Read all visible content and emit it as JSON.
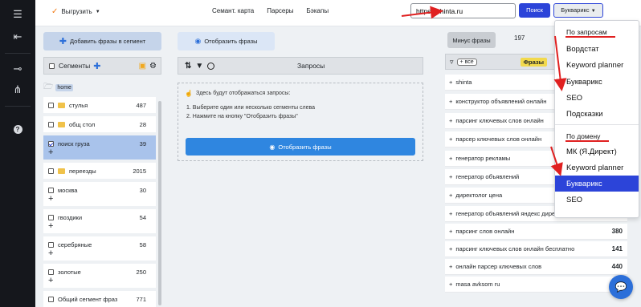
{
  "colors": {
    "accent": "#2c44d9",
    "annotation": "#e02020",
    "selected_row": "#a9c3eb"
  },
  "rail": {
    "icons": [
      "menu-icon",
      "logout-icon",
      "key-icon",
      "hierarchy-icon",
      "help-icon"
    ]
  },
  "topbar": {
    "export_label": "Выгрузить",
    "nav": [
      "Семант. карта",
      "Парсеры",
      "Бэкапы"
    ],
    "url_value": "https://shinta.ru",
    "search_label": "Поиск",
    "provider_label": "Букварикс"
  },
  "segments_panel": {
    "add_button": "Добавить фразы в сегмент",
    "header": "Сегменты",
    "home_label": "home",
    "items": [
      {
        "label": "стулья",
        "count": "487",
        "folder": true,
        "checked": false
      },
      {
        "label": "общ стол",
        "count": "28",
        "folder": true,
        "checked": false
      },
      {
        "label": "поиск груза",
        "count": "39",
        "folder": false,
        "checked": true
      },
      {
        "label": "переезды",
        "count": "2015",
        "folder": true,
        "checked": false
      },
      {
        "label": "москва",
        "count": "30",
        "folder": false,
        "checked": false
      },
      {
        "label": "гвоздики",
        "count": "54",
        "folder": false,
        "checked": false
      },
      {
        "label": "серебряные",
        "count": "58",
        "folder": false,
        "checked": false
      },
      {
        "label": "золотые",
        "count": "250",
        "folder": false,
        "checked": false
      },
      {
        "label": "Общий сегмент фраз",
        "count": "771",
        "folder": false,
        "checked": false
      }
    ]
  },
  "queries_panel": {
    "show_button": "Отобразить фразы",
    "header": "Запросы",
    "hint_title": "Здесь будут отображаться запросы:",
    "hint_steps": [
      "1. Выберите один или несколько сегменты слева",
      "2. Нажмите на кнопку \"Отобразить фразы\""
    ],
    "show_button_big": "Отобразить фразы"
  },
  "right_panel": {
    "minus_button": "Минус фразы",
    "count": "197",
    "filter_all": "+ все",
    "phrases_badge": "Фразы",
    "rows": [
      {
        "text": "shinta",
        "num": ""
      },
      {
        "text": "конструктор объявлений онлайн",
        "num": ""
      },
      {
        "text": "парсинг ключевых слов онлайн",
        "num": ""
      },
      {
        "text": "парсер ключевых слов онлайн",
        "num": ""
      },
      {
        "text": "генератор рекламы",
        "num": ""
      },
      {
        "text": "генератор объявлений",
        "num": ""
      },
      {
        "text": "директолог цена",
        "num": ""
      },
      {
        "text": "генератор объявлений яндекс директ",
        "num": ""
      },
      {
        "text": "парсинг слов онлайн",
        "num": "380"
      },
      {
        "text": "парсинг ключевых слов онлайн бесплатно",
        "num": "141"
      },
      {
        "text": "онлайн парсер ключевых слов",
        "num": "440"
      },
      {
        "text": "masa avksom ru",
        "num": ""
      }
    ]
  },
  "dropdown": {
    "section1": "По запросам",
    "items1": [
      "Вордстат",
      "Keyword planner",
      "Букварикс",
      "SEO",
      "Подсказки"
    ],
    "section2": "По домену",
    "items2": [
      "МК (Я.Директ)",
      "Keyword planner",
      "Букварикс",
      "SEO"
    ],
    "active_item": "Букварикс"
  }
}
